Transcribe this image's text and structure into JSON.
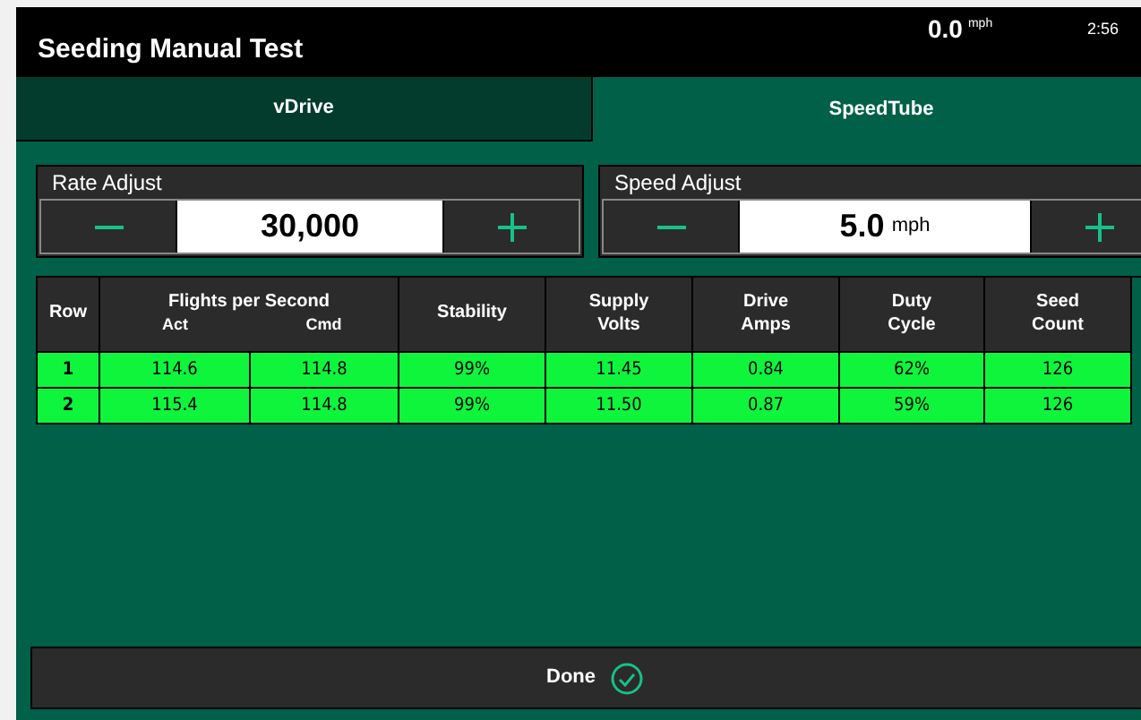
{
  "header": {
    "title": "Seeding Manual Test",
    "speed": "0.0",
    "speed_unit": "mph",
    "time": "2:56"
  },
  "tabs": [
    {
      "label": "vDrive",
      "selected": false
    },
    {
      "label": "SpeedTube",
      "selected": true
    }
  ],
  "adjusters": [
    {
      "label": "Rate Adjust",
      "value": "30,000"
    },
    {
      "label": "Speed Adjust",
      "value": "5.0",
      "unit": "mph"
    }
  ],
  "table": {
    "columns": [
      {
        "label": "Row"
      },
      {
        "label": "Act",
        "group": "Flights per Second"
      },
      {
        "label": "Cmd",
        "in_group": true
      },
      {
        "label": "Stability"
      },
      {
        "label": "Supply Volts"
      },
      {
        "label": "Drive Amps"
      },
      {
        "label": "Duty Cycle"
      },
      {
        "label": "Seed Count"
      }
    ],
    "rows": [
      [
        "1",
        "114.6",
        "114.8",
        "99%",
        "11.45",
        "0.84",
        "62%",
        "126"
      ],
      [
        "2",
        "115.4",
        "114.8",
        "99%",
        "11.50",
        "0.87",
        "59%",
        "126"
      ]
    ]
  },
  "done_button": {
    "label": "Done"
  }
}
